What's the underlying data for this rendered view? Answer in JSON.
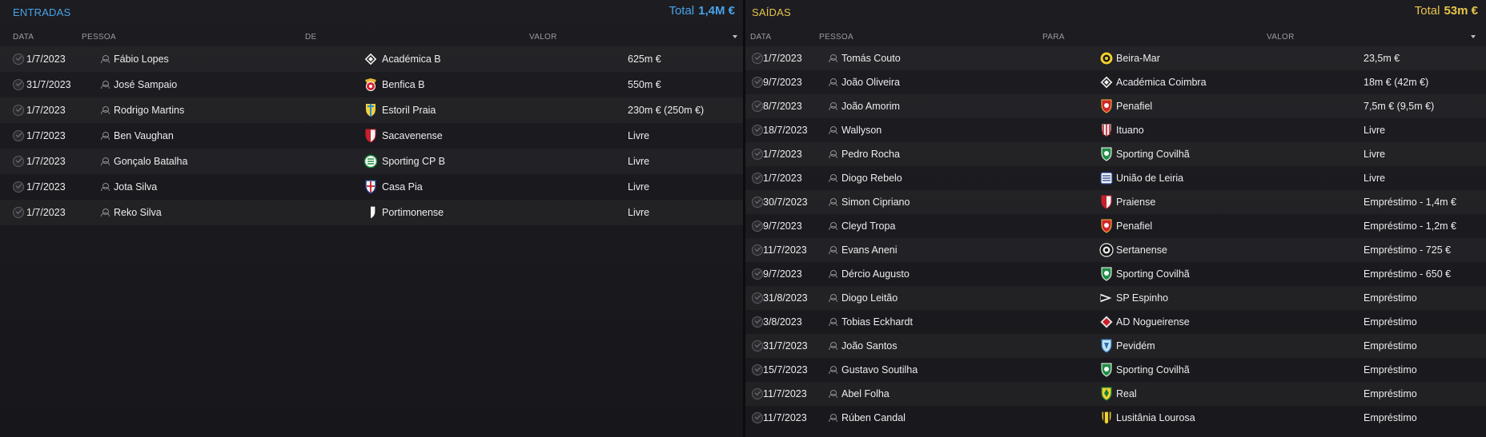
{
  "entradas": {
    "title": "ENTRADAS",
    "total_label": "Total",
    "total_value": "1,4M €",
    "columns": {
      "date": "DATA",
      "person": "PESSOA",
      "club": "DE",
      "value": "VALOR"
    },
    "rows": [
      {
        "date": "1/7/2023",
        "person": "Fábio Lopes",
        "club": "Académica B",
        "crest": "diamond",
        "value": "625m €"
      },
      {
        "date": "31/7/2023",
        "person": "José Sampaio",
        "club": "Benfica B",
        "crest": "eagle-red",
        "value": "550m €"
      },
      {
        "date": "1/7/2023",
        "person": "Rodrigo Martins",
        "club": "Estoril Praia",
        "crest": "shield-yellow",
        "value": "230m € (250m €)"
      },
      {
        "date": "1/7/2023",
        "person": "Ben Vaughan",
        "club": "Sacavenense",
        "crest": "shield-red-white",
        "value": "Livre"
      },
      {
        "date": "1/7/2023",
        "person": "Gonçalo Batalha",
        "club": "Sporting CP B",
        "crest": "round-green",
        "value": "Livre"
      },
      {
        "date": "1/7/2023",
        "person": "Jota Silva",
        "club": "Casa Pia",
        "crest": "shield-blue-red",
        "value": "Livre"
      },
      {
        "date": "1/7/2023",
        "person": "Reko Silva",
        "club": "Portimonense",
        "crest": "shield-black-white",
        "value": "Livre"
      }
    ]
  },
  "saidas": {
    "title": "SAÍDAS",
    "total_label": "Total",
    "total_value": "53m €",
    "columns": {
      "date": "DATA",
      "person": "PESSOA",
      "club": "PARA",
      "value": "VALOR"
    },
    "rows": [
      {
        "date": "1/7/2023",
        "person": "Tomás Couto",
        "club": "Beira-Mar",
        "crest": "round-yellow",
        "value": "23,5m €"
      },
      {
        "date": "9/7/2023",
        "person": "João Oliveira",
        "club": "Académica Coimbra",
        "crest": "diamond",
        "value": "18m € (42m €)"
      },
      {
        "date": "8/7/2023",
        "person": "João Amorim",
        "club": "Penafiel",
        "crest": "shield-red",
        "value": "7,5m € (9,5m €)"
      },
      {
        "date": "18/7/2023",
        "person": "Wallyson",
        "club": "Ituano",
        "crest": "shield-red-black",
        "value": "Livre"
      },
      {
        "date": "1/7/2023",
        "person": "Pedro Rocha",
        "club": "Sporting Covilhã",
        "crest": "shield-green",
        "value": "Livre"
      },
      {
        "date": "1/7/2023",
        "person": "Diogo Rebelo",
        "club": "União de Leiria",
        "crest": "shield-blue-white",
        "value": "Livre"
      },
      {
        "date": "30/7/2023",
        "person": "Simon Cipriano",
        "club": "Praiense",
        "crest": "shield-red-white",
        "value": "Empréstimo - 1,4m €"
      },
      {
        "date": "9/7/2023",
        "person": "Cleyd Tropa",
        "club": "Penafiel",
        "crest": "shield-red",
        "value": "Empréstimo - 1,2m €"
      },
      {
        "date": "11/7/2023",
        "person": "Evans Aneni",
        "club": "Sertanense",
        "crest": "round-black-white",
        "value": "Empréstimo - 725 €"
      },
      {
        "date": "9/7/2023",
        "person": "Dércio Augusto",
        "club": "Sporting Covilhã",
        "crest": "shield-green",
        "value": "Empréstimo - 650 €"
      },
      {
        "date": "31/8/2023",
        "person": "Diogo Leitão",
        "club": "SP Espinho",
        "crest": "pennant",
        "value": "Empréstimo"
      },
      {
        "date": "3/8/2023",
        "person": "Tobias Eckhardt",
        "club": "AD Nogueirense",
        "crest": "diamond-red",
        "value": "Empréstimo"
      },
      {
        "date": "31/7/2023",
        "person": "João Santos",
        "club": "Pevidém",
        "crest": "shield-lightblue",
        "value": "Empréstimo"
      },
      {
        "date": "15/7/2023",
        "person": "Gustavo Soutilha",
        "club": "Sporting Covilhã",
        "crest": "shield-green",
        "value": "Empréstimo"
      },
      {
        "date": "11/7/2023",
        "person": "Abel Folha",
        "club": "Real",
        "crest": "shield-yellow-green",
        "value": "Empréstimo"
      },
      {
        "date": "11/7/2023",
        "person": "Rúben Candal",
        "club": "Lusitânia Lourosa",
        "crest": "shield-yellow-black",
        "value": "Empréstimo"
      }
    ]
  }
}
